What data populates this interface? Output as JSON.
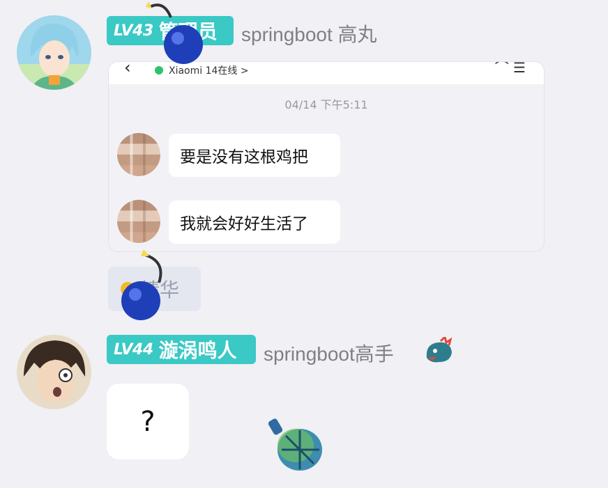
{
  "messages": [
    {
      "level": "LV43",
      "role": "管理员",
      "title": "springboot 高丸",
      "screenshot": {
        "device": "Xiaomi 14在线 >",
        "time": "04/14 下午5:11",
        "lines": [
          "要是没有这根鸡把",
          "我就会好好生活了"
        ]
      },
      "tag": "精华"
    },
    {
      "level": "LV44",
      "name": "漩涡鸣人",
      "title": "springboot高手",
      "text": "?"
    }
  ],
  "colors": {
    "badge": "#3ac9c4",
    "background": "#f0f0f5",
    "online": "#2ec36c"
  },
  "icons": [
    "bomb-icon",
    "dragon-icon",
    "grenade-icon",
    "essence-icon"
  ]
}
